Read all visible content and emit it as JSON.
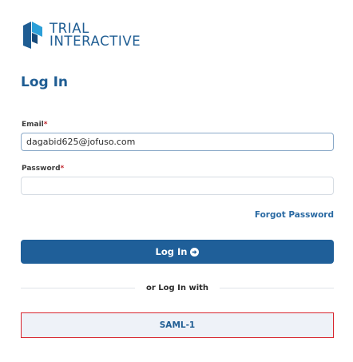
{
  "brand": {
    "line1": "TRIAL",
    "line2": "INTERACTIVE",
    "colors": {
      "primary": "#1f5d93",
      "accent": "#d8242d"
    }
  },
  "page": {
    "title": "Log In"
  },
  "form": {
    "email": {
      "label": "Email",
      "required_mark": "*",
      "value": "dagabid625@jofuso.com"
    },
    "password": {
      "label": "Password",
      "required_mark": "*",
      "value": ""
    },
    "forgot_password": "Forgot Password",
    "submit_label": "Log In",
    "submit_icon": "arrow-circle-right-icon"
  },
  "alt_login": {
    "divider_text": "or Log In with",
    "providers": [
      {
        "label": "SAML-1"
      }
    ]
  }
}
